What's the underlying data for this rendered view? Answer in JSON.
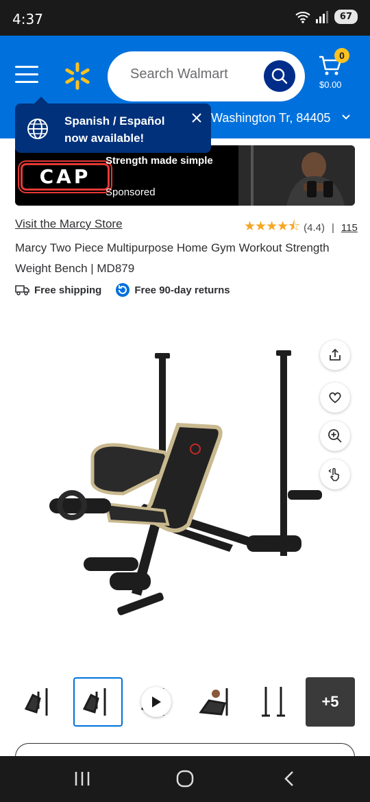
{
  "status_bar": {
    "time": "4:37",
    "battery": "67"
  },
  "header": {
    "search_placeholder": "Search Walmart",
    "cart_count": "0",
    "cart_total": "$0.00",
    "location": "Washington Tr, 84405"
  },
  "tooltip": {
    "message": "Spanish / Español now available!"
  },
  "ad": {
    "brand": "CAP",
    "tagline": "Strength made simple",
    "sponsored": "Sponsored"
  },
  "product": {
    "store_link": "Visit the Marcy Store",
    "rating": "(4.4)",
    "rating_value": 4.4,
    "separator": "|",
    "review_count": "115",
    "title": "Marcy Two Piece Multipurpose Home Gym Workout Strength Weight Bench | MD879",
    "free_shipping": "Free shipping",
    "free_returns": "Free 90-day returns"
  },
  "thumbnails": {
    "more_label": "+5"
  },
  "colors": {
    "brand_blue": "#0071dc",
    "dark_blue": "#002d8a",
    "spark_yellow": "#ffc220"
  }
}
